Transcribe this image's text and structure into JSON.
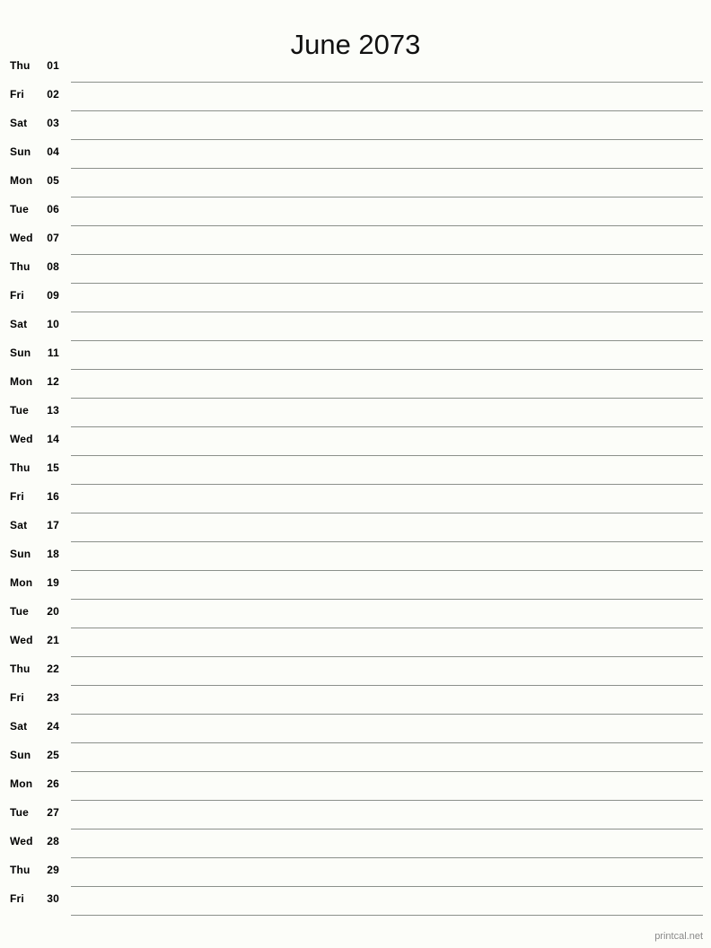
{
  "header": {
    "title": "June 2073"
  },
  "footer": {
    "watermark": "printcal.net"
  },
  "calendar": {
    "month": "June",
    "year": "2073",
    "days": [
      {
        "weekday": "Thu",
        "number": "01"
      },
      {
        "weekday": "Fri",
        "number": "02"
      },
      {
        "weekday": "Sat",
        "number": "03"
      },
      {
        "weekday": "Sun",
        "number": "04"
      },
      {
        "weekday": "Mon",
        "number": "05"
      },
      {
        "weekday": "Tue",
        "number": "06"
      },
      {
        "weekday": "Wed",
        "number": "07"
      },
      {
        "weekday": "Thu",
        "number": "08"
      },
      {
        "weekday": "Fri",
        "number": "09"
      },
      {
        "weekday": "Sat",
        "number": "10"
      },
      {
        "weekday": "Sun",
        "number": "11"
      },
      {
        "weekday": "Mon",
        "number": "12"
      },
      {
        "weekday": "Tue",
        "number": "13"
      },
      {
        "weekday": "Wed",
        "number": "14"
      },
      {
        "weekday": "Thu",
        "number": "15"
      },
      {
        "weekday": "Fri",
        "number": "16"
      },
      {
        "weekday": "Sat",
        "number": "17"
      },
      {
        "weekday": "Sun",
        "number": "18"
      },
      {
        "weekday": "Mon",
        "number": "19"
      },
      {
        "weekday": "Tue",
        "number": "20"
      },
      {
        "weekday": "Wed",
        "number": "21"
      },
      {
        "weekday": "Thu",
        "number": "22"
      },
      {
        "weekday": "Fri",
        "number": "23"
      },
      {
        "weekday": "Sat",
        "number": "24"
      },
      {
        "weekday": "Sun",
        "number": "25"
      },
      {
        "weekday": "Mon",
        "number": "26"
      },
      {
        "weekday": "Tue",
        "number": "27"
      },
      {
        "weekday": "Wed",
        "number": "28"
      },
      {
        "weekday": "Thu",
        "number": "29"
      },
      {
        "weekday": "Fri",
        "number": "30"
      }
    ]
  },
  "colors": {
    "background": "#fcfdf9",
    "text": "#000000",
    "title": "#111111",
    "rule": "#8b908b",
    "watermark": "#8a8a8a"
  }
}
